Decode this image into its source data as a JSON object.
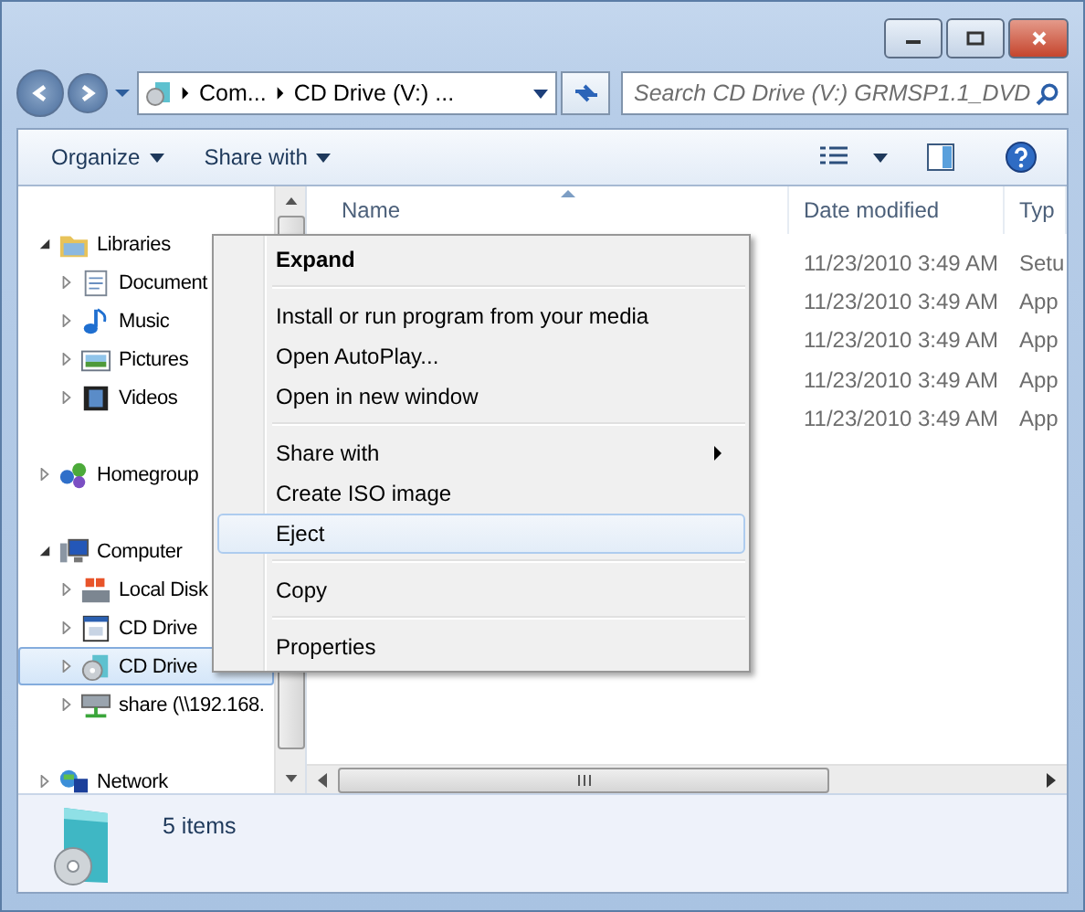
{
  "address_bar": {
    "crumbs": [
      "Com...",
      "CD Drive (V:) ..."
    ]
  },
  "search": {
    "placeholder": "Search CD Drive (V:) GRMSP1.1_DVD"
  },
  "toolbar": {
    "buttons": [
      "Organize",
      "Share with"
    ]
  },
  "navigation": [
    {
      "label": "Libraries",
      "kind": "library",
      "expanded": true,
      "selected": false,
      "children": [
        {
          "label": "Document",
          "kind": "documents",
          "expanded": false,
          "selected": false
        },
        {
          "label": "Music",
          "kind": "music",
          "expanded": false,
          "selected": false
        },
        {
          "label": "Pictures",
          "kind": "pictures",
          "expanded": false,
          "selected": false
        },
        {
          "label": "Videos",
          "kind": "videos",
          "expanded": false,
          "selected": false
        }
      ]
    },
    {
      "label": "Homegroup",
      "kind": "homegroup",
      "expanded": false,
      "selected": false
    },
    {
      "label": "Computer",
      "kind": "computer",
      "expanded": true,
      "selected": false,
      "children": [
        {
          "label": "Local Disk",
          "kind": "local-disk",
          "expanded": false,
          "selected": false
        },
        {
          "label": "CD Drive",
          "kind": "autorun-drive",
          "expanded": false,
          "selected": false
        },
        {
          "label": "CD Drive",
          "kind": "cd-drive",
          "expanded": false,
          "selected": true
        },
        {
          "label": "share (\\\\192.168.",
          "kind": "network-drive",
          "expanded": false,
          "selected": false
        }
      ]
    },
    {
      "label": "Network",
      "kind": "network",
      "expanded": false,
      "selected": false
    }
  ],
  "file_list": {
    "columns": [
      "Name",
      "Date modified",
      "Typ"
    ],
    "rows": [
      {
        "date_modified": "11/23/2010 3:49 AM",
        "type": "Setu"
      },
      {
        "date_modified": "11/23/2010 3:49 AM",
        "type": "App"
      },
      {
        "date_modified": "11/23/2010 3:49 AM",
        "type": "App"
      },
      {
        "date_modified": "11/23/2010 3:49 AM",
        "type": "App"
      },
      {
        "date_modified": "11/23/2010 3:49 AM",
        "type": "App"
      }
    ]
  },
  "context_menu": {
    "groups": [
      [
        {
          "label": "Expand",
          "default": true,
          "submenu": false,
          "hovered": false
        }
      ],
      [
        {
          "label": "Install or run program from your media",
          "default": false,
          "submenu": false,
          "hovered": false
        },
        {
          "label": "Open AutoPlay...",
          "default": false,
          "submenu": false,
          "hovered": false
        },
        {
          "label": "Open in new window",
          "default": false,
          "submenu": false,
          "hovered": false
        }
      ],
      [
        {
          "label": "Share with",
          "default": false,
          "submenu": true,
          "hovered": false
        },
        {
          "label": "Create ISO image",
          "default": false,
          "submenu": false,
          "hovered": false
        },
        {
          "label": "Eject",
          "default": false,
          "submenu": false,
          "hovered": true
        }
      ],
      [
        {
          "label": "Copy",
          "default": false,
          "submenu": false,
          "hovered": false
        }
      ],
      [
        {
          "label": "Properties",
          "default": false,
          "submenu": false,
          "hovered": false
        }
      ]
    ]
  },
  "status_bar": {
    "text": "5 items"
  }
}
